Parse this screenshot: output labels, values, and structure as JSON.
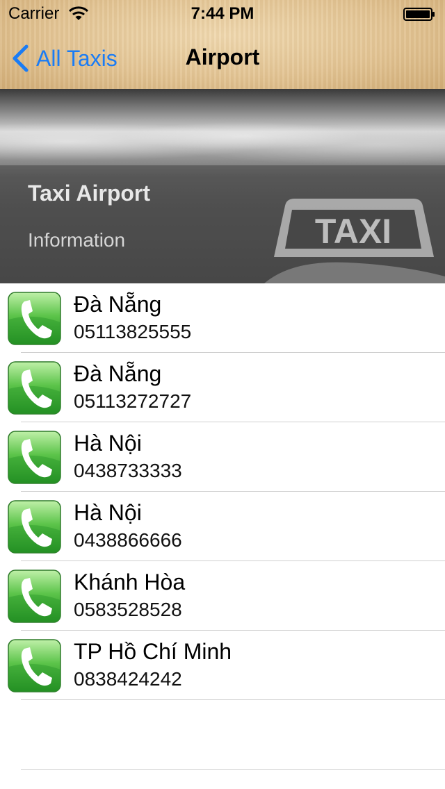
{
  "status": {
    "carrier": "Carrier",
    "time": "7:44 PM"
  },
  "nav": {
    "back_label": "All Taxis",
    "title": "Airport"
  },
  "hero": {
    "title": "Taxi Airport",
    "subtitle": "Information",
    "sign_text": "TAXI"
  },
  "colors": {
    "link": "#1a7cf5",
    "call_green": "#3fae3a"
  },
  "taxis": [
    {
      "city": "Đà Nẵng",
      "phone": "05113825555"
    },
    {
      "city": "Đà Nẵng",
      "phone": "05113272727"
    },
    {
      "city": "Hà Nội",
      "phone": "0438733333"
    },
    {
      "city": "Hà Nội",
      "phone": "0438866666"
    },
    {
      "city": "Khánh Hòa",
      "phone": "0583528528"
    },
    {
      "city": "TP Hồ Chí Minh",
      "phone": "0838424242"
    }
  ]
}
